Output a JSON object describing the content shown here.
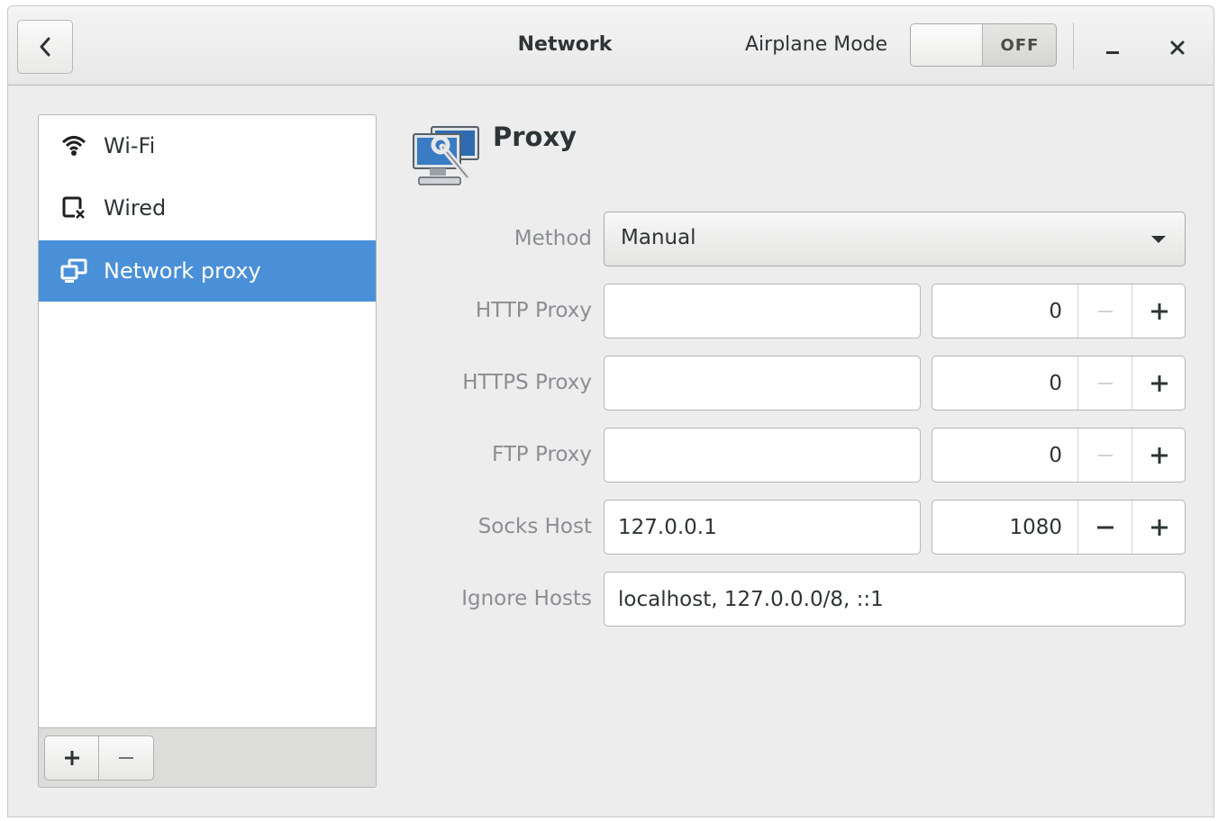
{
  "header": {
    "title": "Network",
    "airplane_mode_label": "Airplane Mode",
    "airplane_mode_state": "OFF"
  },
  "sidebar": {
    "items": [
      {
        "label": "Wi-Fi",
        "icon": "wifi-icon"
      },
      {
        "label": "Wired",
        "icon": "wired-disconnected-icon"
      },
      {
        "label": "Network proxy",
        "icon": "network-proxy-icon",
        "selected": true
      }
    ],
    "add_label": "+",
    "remove_label": "−"
  },
  "proxy": {
    "title": "Proxy",
    "method_label": "Method",
    "method_value": "Manual",
    "http_label": "HTTP Proxy",
    "http_host": "",
    "http_port": "0",
    "https_label": "HTTPS Proxy",
    "https_host": "",
    "https_port": "0",
    "ftp_label": "FTP Proxy",
    "ftp_host": "",
    "ftp_port": "0",
    "socks_label": "Socks Host",
    "socks_host": "127.0.0.1",
    "socks_port": "1080",
    "ignore_label": "Ignore Hosts",
    "ignore_value": "localhost, 127.0.0.0/8, ::1"
  },
  "colors": {
    "selection": "#4a90d9",
    "background": "#ededed",
    "label_gray": "#8b8e8f"
  }
}
